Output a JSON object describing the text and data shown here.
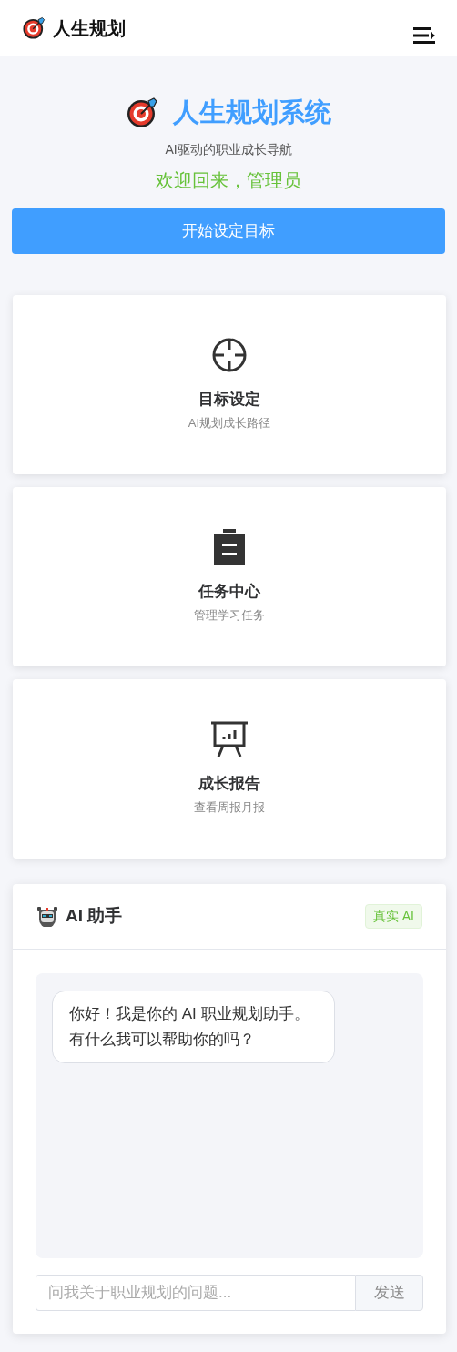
{
  "navbar": {
    "brand": "人生规划"
  },
  "hero": {
    "title": "人生规划系统",
    "subtitle": "AI驱动的职业成长导航",
    "welcome": "欢迎回来，管理员",
    "button": "开始设定目标"
  },
  "features": [
    {
      "kind": "target",
      "title": "目标设定",
      "desc": "AI规划成长路径"
    },
    {
      "kind": "clipboard",
      "title": "任务中心",
      "desc": "管理学习任务"
    },
    {
      "kind": "presentation",
      "title": "成长报告",
      "desc": "查看周报月报"
    }
  ],
  "assistant": {
    "title": "AI 助手",
    "tag": "真实 AI",
    "messages": [
      {
        "text": "你好！我是你的 AI 职业规划助手。有什么我可以帮助你的吗？"
      }
    ],
    "input": {
      "placeholder": "问我关于职业规划的问题..."
    },
    "send": "发送"
  }
}
